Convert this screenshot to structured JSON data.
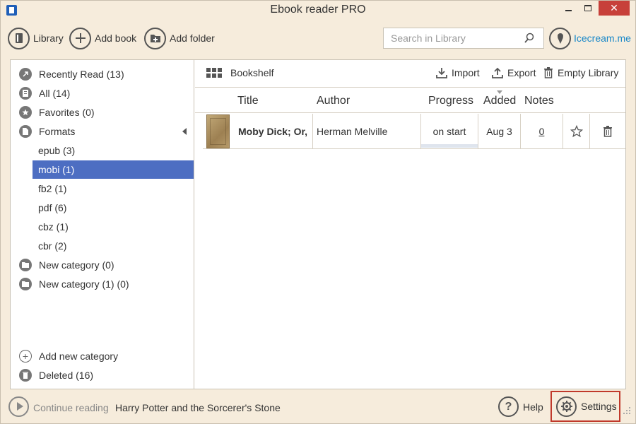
{
  "window": {
    "title": "Ebook reader PRO",
    "close_glyph": "✕"
  },
  "toolbar": {
    "library_label": "Library",
    "add_book_label": "Add book",
    "add_folder_label": "Add folder",
    "search_placeholder": "Search in Library",
    "brand_label": "Icecream.me"
  },
  "sidebar": {
    "items": [
      {
        "label": "Recently Read (13)",
        "icon": "recent-icon"
      },
      {
        "label": "All (14)",
        "icon": "books-icon"
      },
      {
        "label": "Favorites (0)",
        "icon": "star-icon"
      },
      {
        "label": "Formats",
        "icon": "formats-icon"
      },
      {
        "label": "epub (3)"
      },
      {
        "label": "mobi (1)"
      },
      {
        "label": "fb2 (1)"
      },
      {
        "label": "pdf (6)"
      },
      {
        "label": "cbz (1)"
      },
      {
        "label": "cbr (2)"
      },
      {
        "label": "New category (0)",
        "icon": "folder-icon"
      },
      {
        "label": "New category (1) (0)",
        "icon": "folder-icon"
      }
    ],
    "add_category_label": "Add new category",
    "deleted_label": "Deleted (16)",
    "selected_index": 5
  },
  "content": {
    "bookshelf_label": "Bookshelf",
    "import_label": "Import",
    "export_label": "Export",
    "empty_library_label": "Empty Library",
    "columns": [
      "Title",
      "Author",
      "Progress",
      "Added",
      "Notes"
    ],
    "books": [
      {
        "title": "Moby Dick; Or,",
        "author": "Herman Melville",
        "progress": "on start",
        "progress_fraction": 0,
        "added": "Aug 3",
        "notes": "0"
      }
    ]
  },
  "bottombar": {
    "continue_label": "Continue reading",
    "continue_book": "Harry Potter and the Sorcerer's Stone",
    "help_label": "Help",
    "settings_label": "Settings"
  },
  "colors": {
    "background": "#f6ecdc",
    "selection": "#4d6ec2",
    "close_button": "#c7403a",
    "brand": "#1a88c8",
    "settings_highlight": "#c0392b"
  }
}
